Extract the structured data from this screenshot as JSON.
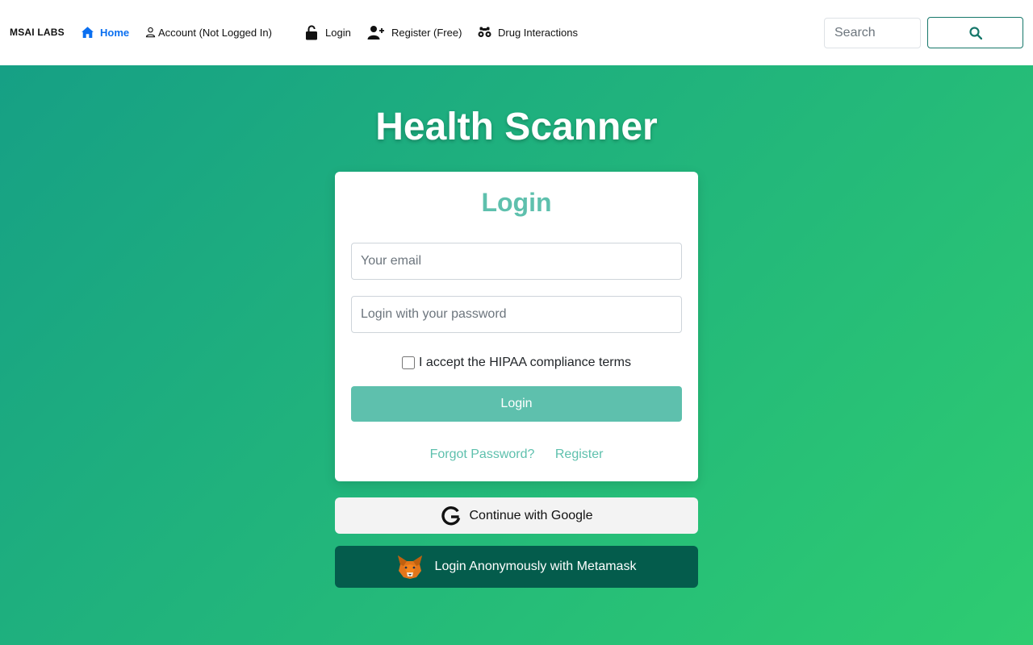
{
  "nav": {
    "brand": "MSAI LABS",
    "items": [
      {
        "label": "Home",
        "icon": "house-icon"
      },
      {
        "label": "Account (Not Logged In)",
        "icon": "person-icon"
      },
      {
        "label": "Login",
        "icon": "unlock-icon"
      },
      {
        "label": "Register (Free)",
        "icon": "person-plus-icon"
      },
      {
        "label": "Drug Interactions",
        "icon": "binoculars-icon"
      }
    ],
    "search": {
      "placeholder": "Search",
      "button_icon": "search-icon"
    }
  },
  "page": {
    "title": "Health Scanner"
  },
  "login_card": {
    "title": "Login",
    "email_placeholder": "Your email",
    "password_placeholder": "Login with your password",
    "terms_label": "I accept the HIPAA compliance terms",
    "terms_checked": false,
    "submit_label": "Login",
    "forgot_password_link": "Forgot Password?",
    "register_link": "Register"
  },
  "social": {
    "google_label": "Continue with Google",
    "metamask_label": "Login Anonymously with Metamask"
  },
  "colors": {
    "gradient_start": "#16a085",
    "gradient_end": "#2ecc71",
    "accent": "#5ec0ad",
    "nav_active": "#0a6ff0",
    "metamask_button": "#045c4c"
  }
}
